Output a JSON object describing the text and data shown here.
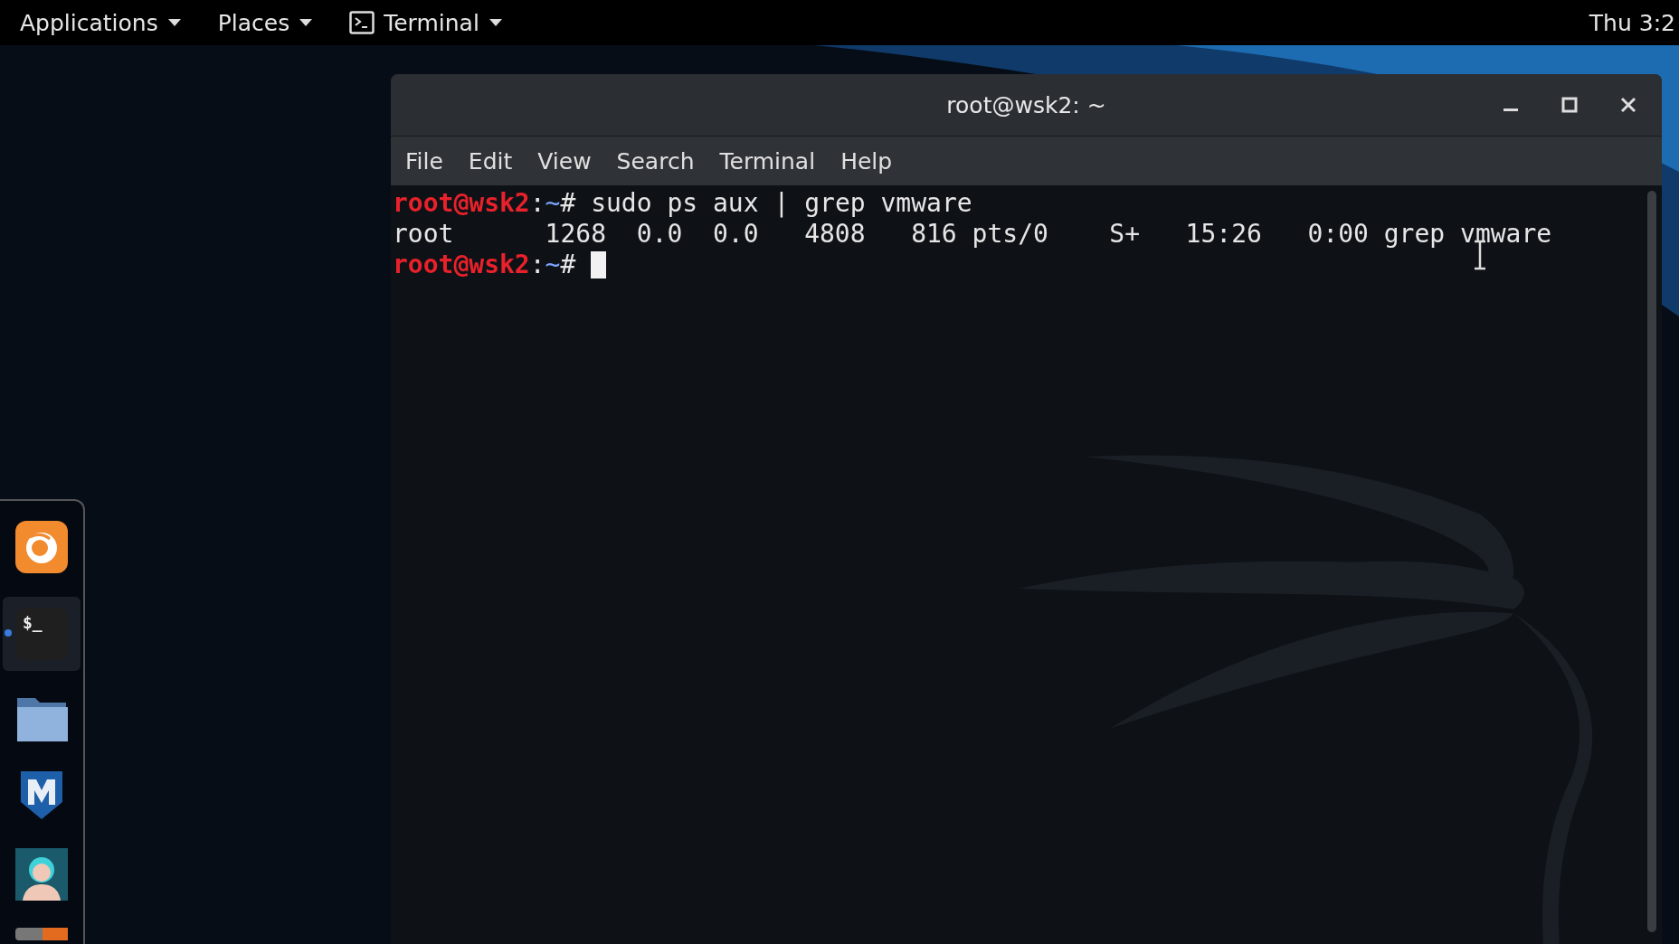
{
  "top_bar": {
    "menus": [
      {
        "label": "Applications",
        "icon": false
      },
      {
        "label": "Places",
        "icon": false
      },
      {
        "label": "Terminal",
        "icon": true
      }
    ],
    "clock": "Thu 3:2"
  },
  "dock": {
    "items": [
      {
        "kind": "browser",
        "running": false,
        "selected": false
      },
      {
        "kind": "terminal",
        "glyph": "$_",
        "running": true,
        "selected": true
      },
      {
        "kind": "files",
        "running": false,
        "selected": false
      },
      {
        "kind": "shield",
        "running": false,
        "selected": false
      },
      {
        "kind": "avatar",
        "running": false,
        "selected": false
      },
      {
        "kind": "partial",
        "running": false,
        "selected": false
      }
    ]
  },
  "window": {
    "title": "root@wsk2: ~",
    "menu": [
      "File",
      "Edit",
      "View",
      "Search",
      "Terminal",
      "Help"
    ],
    "lines": [
      {
        "kind": "prompt",
        "user_host": "root@wsk2",
        "sep": ":",
        "path": "~",
        "symbol": "# ",
        "command": "sudo ps aux | grep vmware",
        "cursor": false
      },
      {
        "kind": "output",
        "text": "root      1268  0.0  0.0   4808   816 pts/0    S+   15:26   0:00 grep vmware"
      },
      {
        "kind": "prompt",
        "user_host": "root@wsk2",
        "sep": ":",
        "path": "~",
        "symbol": "# ",
        "cursor": true
      }
    ]
  }
}
